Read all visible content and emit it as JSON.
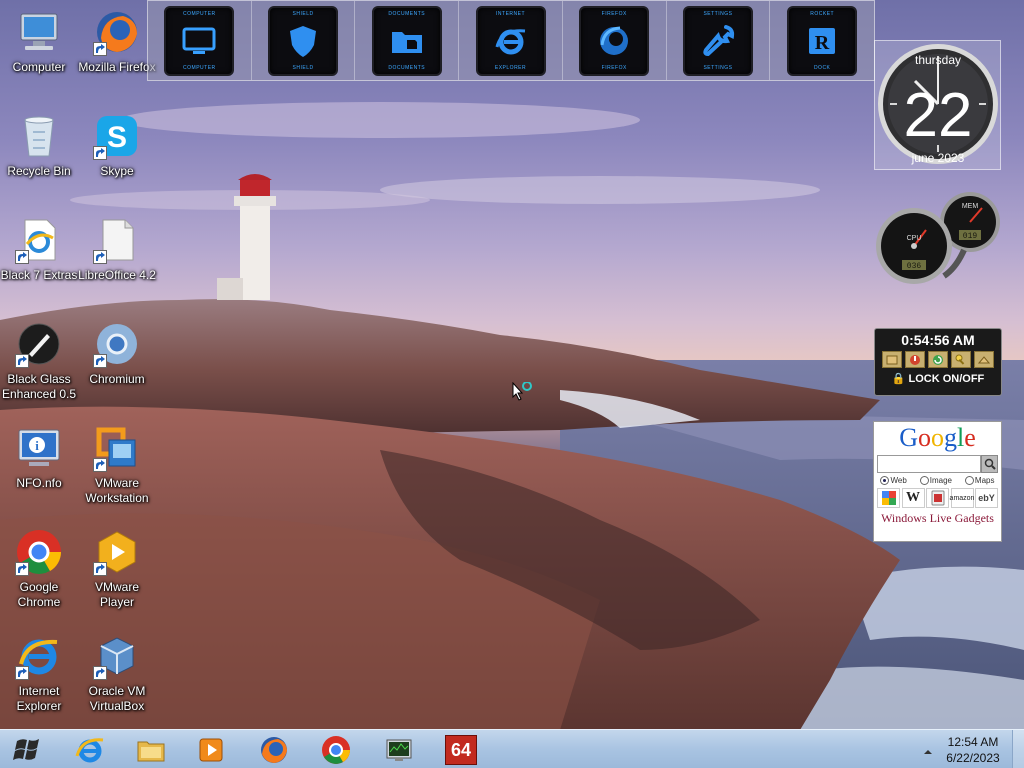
{
  "desktop": {
    "icons": [
      {
        "label": "Computer",
        "icon": "computer-icon"
      },
      {
        "label": "Mozilla Firefox",
        "icon": "firefox-icon"
      },
      {
        "label": "Recycle Bin",
        "icon": "recycle-bin-icon"
      },
      {
        "label": "Skype",
        "icon": "skype-icon"
      },
      {
        "label": "Black 7 Extras",
        "icon": "ie-file-icon"
      },
      {
        "label": "LibreOffice 4.2",
        "icon": "libreoffice-icon"
      },
      {
        "label": "Black Glass Enhanced 0.5",
        "icon": "black-glass-icon"
      },
      {
        "label": "Chromium",
        "icon": "chromium-icon"
      },
      {
        "label": "NFO.nfo",
        "icon": "nfo-icon"
      },
      {
        "label": "VMware Workstation",
        "icon": "vmware-workstation-icon"
      },
      {
        "label": "Google Chrome",
        "icon": "chrome-icon"
      },
      {
        "label": "VMware Player",
        "icon": "vmware-player-icon"
      },
      {
        "label": "Internet Explorer",
        "icon": "internet-explorer-icon"
      },
      {
        "label": "Oracle VM VirtualBox",
        "icon": "virtualbox-icon"
      }
    ]
  },
  "launcher": {
    "items": [
      {
        "top": "COMPUTER",
        "bottom": "COMPUTER",
        "icon": "monitor-icon"
      },
      {
        "top": "SHIELD",
        "bottom": "SHIELD",
        "icon": "shield-icon"
      },
      {
        "top": "DOCUMENTS",
        "bottom": "DOCUMENTS",
        "icon": "folder-icon"
      },
      {
        "top": "INTERNET",
        "bottom": "EXPLORER",
        "icon": "internet-explorer-icon"
      },
      {
        "top": "FIREFOX",
        "bottom": "FIREFOX",
        "icon": "firefox-icon"
      },
      {
        "top": "SETTINGS",
        "bottom": "SETTINGS",
        "icon": "wrench-icon"
      },
      {
        "top": "ROCKET",
        "bottom": "DOCK",
        "icon": "rocketdock-icon"
      }
    ]
  },
  "clock_gadget": {
    "weekday": "thursday",
    "day": "22",
    "month_year": "june 2023"
  },
  "meter_gadget": {
    "cpu_label": "CPU",
    "mem_label": "MEM",
    "cpu_readout": "036",
    "mem_readout": "019"
  },
  "timer_gadget": {
    "time": "0:54:56 AM",
    "lock_label": "LOCK ON/OFF"
  },
  "google_gadget": {
    "logo": "Google",
    "logo_colors": [
      "#1a5dc8",
      "#d62d20",
      "#f0b400",
      "#1a5dc8",
      "#0f9d58",
      "#d62d20"
    ],
    "radios": [
      {
        "label": "Web",
        "checked": true
      },
      {
        "label": "Image",
        "checked": false
      },
      {
        "label": "Maps",
        "checked": false
      }
    ],
    "sites": [
      "google-icon",
      "W",
      "youtube-icon",
      "amazon",
      "ebY"
    ],
    "footer": "Windows Live Gadgets"
  },
  "taskbar": {
    "pinned": [
      "internet-explorer-icon",
      "explorer-icon",
      "media-player-icon",
      "firefox-icon",
      "chrome-icon",
      "task-manager-icon",
      "aida64-icon"
    ],
    "aida_label": "64",
    "time": "12:54 AM",
    "date": "6/22/2023"
  }
}
